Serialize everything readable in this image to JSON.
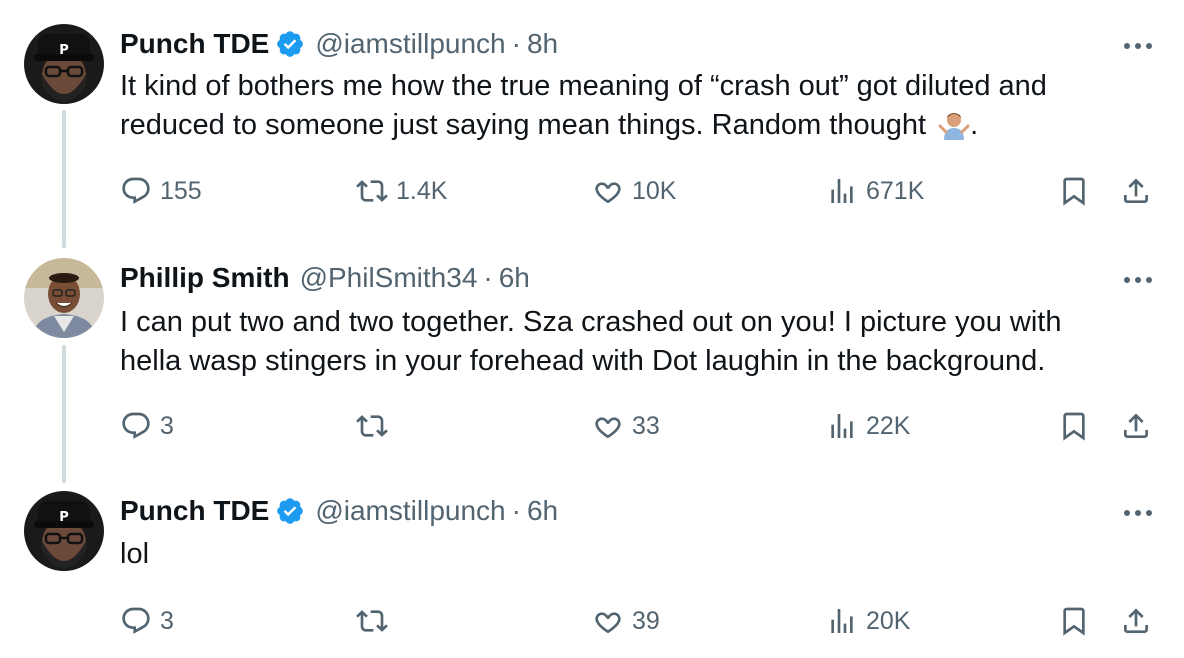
{
  "tweets": [
    {
      "name": "Punch TDE",
      "verified": true,
      "handle": "@iamstillpunch",
      "separator": "·",
      "time": "8h",
      "text": "It kind of bothers me how the true meaning of “crash out” got diluted and\nreduced to someone just saying mean things. Random thought ",
      "text_suffix": ".",
      "emoji_icon": "person-shrugging-emoji",
      "stats": {
        "replies": "155",
        "reposts": "1.4K",
        "likes": "10K",
        "views": "671K"
      }
    },
    {
      "name": "Phillip Smith",
      "verified": false,
      "handle": "@PhilSmith34",
      "separator": "·",
      "time": "6h",
      "text": "I can put two and two together. Sza crashed out on you! I picture you with\nhella wasp stingers in your forehead with Dot laughin in the background.",
      "stats": {
        "replies": "3",
        "reposts": "",
        "likes": "33",
        "views": "22K"
      }
    },
    {
      "name": "Punch TDE",
      "verified": true,
      "handle": "@iamstillpunch",
      "separator": "·",
      "time": "6h",
      "text": "lol",
      "stats": {
        "replies": "3",
        "reposts": "",
        "likes": "39",
        "views": "20K"
      }
    }
  ],
  "avatar_letter": "P",
  "colors": {
    "text": "#0f1419",
    "secondary": "#536471",
    "verified": "#1d9bf0",
    "thread_line": "#cfd9de"
  },
  "icons": [
    "reply-icon",
    "repost-icon",
    "like-icon",
    "views-icon",
    "bookmark-icon",
    "share-icon",
    "more-icon",
    "verified-icon"
  ]
}
